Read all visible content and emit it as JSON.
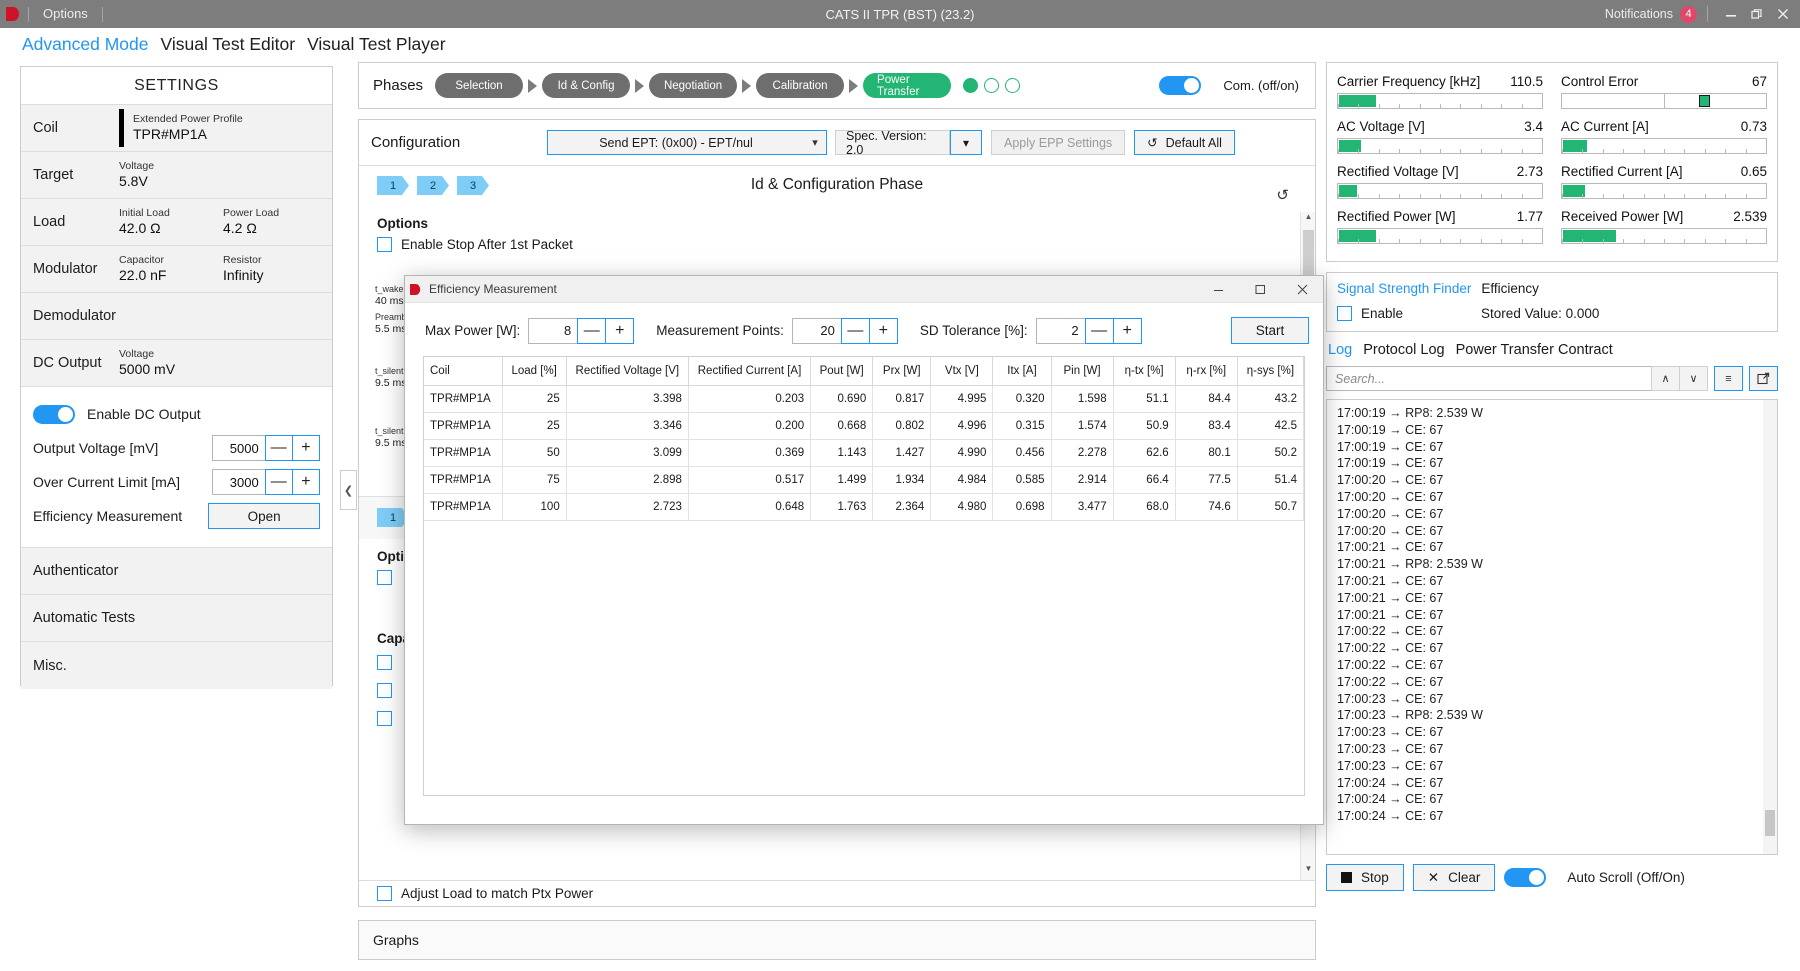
{
  "titlebar": {
    "menu": "Options",
    "app_title": "CATS II TPR (BST) (23.2)",
    "notifications_label": "Notifications",
    "notifications_count": "4",
    "minimize": "—",
    "maximize": "❐",
    "close": "✕"
  },
  "mode_tabs": [
    {
      "label": "Advanced Mode",
      "active": true
    },
    {
      "label": "Visual Test Editor",
      "active": false
    },
    {
      "label": "Visual Test Player",
      "active": false
    }
  ],
  "settings": {
    "header": "SETTINGS",
    "rows": [
      {
        "label": "Coil",
        "accent": true,
        "fields": [
          {
            "cap": "Extended Power Profile",
            "val": "TPR#MP1A"
          }
        ]
      },
      {
        "label": "Target",
        "accent": false,
        "fields": [
          {
            "cap": "Voltage",
            "val": "5.8V"
          }
        ]
      },
      {
        "label": "Load",
        "accent": false,
        "fields": [
          {
            "cap": "Initial Load",
            "val": "42.0 Ω"
          },
          {
            "cap": "Power Load",
            "val": "4.2 Ω"
          }
        ]
      },
      {
        "label": "Modulator",
        "accent": false,
        "fields": [
          {
            "cap": "Capacitor",
            "val": "22.0 nF"
          },
          {
            "cap": "Resistor",
            "val": "Infinity"
          }
        ]
      },
      {
        "label": "Demodulator",
        "accent": false,
        "fields": []
      },
      {
        "label": "DC Output",
        "accent": false,
        "fields": [
          {
            "cap": "Voltage",
            "val": "5000 mV"
          }
        ]
      }
    ],
    "dc_block": {
      "enable_label": "Enable DC Output",
      "enable_on": true,
      "output_voltage_label": "Output Voltage [mV]",
      "output_voltage_value": "5000",
      "over_current_label": "Over Current Limit [mA]",
      "over_current_value": "3000",
      "efficiency_label": "Efficiency Measurement",
      "efficiency_button": "Open",
      "minus": "—",
      "plus": "+"
    },
    "tail_rows": [
      "Authenticator",
      "Automatic Tests",
      "Misc."
    ]
  },
  "phases": {
    "title": "Phases",
    "chips": [
      "Selection",
      "Id & Config",
      "Negotiation",
      "Calibration",
      "Power Transfer"
    ],
    "active_chip": "Power Transfer",
    "dots": [
      true,
      false,
      false
    ],
    "com_label": "Com. (off/on)",
    "com_on": true
  },
  "configuration": {
    "title": "Configuration",
    "send_ept": "Send EPT: (0x00) - EPT/nul",
    "spec_version": "Spec. Version: 2.0",
    "apply_epp": "Apply EPP Settings",
    "default_all": "Default All",
    "refresh_icon": "↺",
    "num_tabs": [
      "1",
      "2",
      "3"
    ],
    "phase_heading": "Id & Configuration Phase",
    "options_heading": "Options",
    "option_stop_after": "Enable Stop After 1st Packet",
    "timings": [
      {
        "cap": "t_wake",
        "val": "40 ms"
      },
      {
        "cap": "Preamble",
        "val": "5.5 ms"
      },
      {
        "cap": "t_silent",
        "val": "9.5 ms"
      },
      {
        "cap": "t_silent",
        "val": "9.5 ms"
      }
    ],
    "lower_tab": "1",
    "lower_options_heading": "Opti",
    "capa_heading": "Capa",
    "adjust_load": "Adjust Load to match Ptx Power"
  },
  "graphs": {
    "title": "Graphs"
  },
  "meters": [
    {
      "name": "Carrier Frequency [kHz]",
      "value": "110.5",
      "fill_pct": 18,
      "type": "bar"
    },
    {
      "name": "Control Error",
      "value": "67",
      "fill_pct": 67,
      "type": "needle"
    },
    {
      "name": "AC Voltage [V]",
      "value": "3.4",
      "fill_pct": 11,
      "type": "bar"
    },
    {
      "name": "AC Current [A]",
      "value": "0.73",
      "fill_pct": 12,
      "type": "bar"
    },
    {
      "name": "Rectified Voltage [V]",
      "value": "2.73",
      "fill_pct": 9,
      "type": "bar"
    },
    {
      "name": "Rectified Current [A]",
      "value": "0.65",
      "fill_pct": 11,
      "type": "bar"
    },
    {
      "name": "Rectified Power [W]",
      "value": "1.77",
      "fill_pct": 18,
      "type": "bar"
    },
    {
      "name": "Received Power [W]",
      "value": "2.539",
      "fill_pct": 26,
      "type": "bar"
    }
  ],
  "signal_strength": {
    "tabs": [
      {
        "label": "Signal Strength Finder",
        "active": true
      },
      {
        "label": "Efficiency",
        "active": false
      }
    ],
    "enable_label": "Enable",
    "enable_checked": false,
    "stored_value": "Stored Value: 0.000"
  },
  "log": {
    "tabs": [
      {
        "label": "Log",
        "active": true
      },
      {
        "label": "Protocol Log",
        "active": false
      },
      {
        "label": "Power Transfer Contract",
        "active": false
      }
    ],
    "search_placeholder": "Search...",
    "up_icon": "∧",
    "down_icon": "∨",
    "list_icon": "≡",
    "popout_icon": "↗",
    "lines": [
      "17:00:19  → RP8: 2.539 W",
      "17:00:19  → CE: 67",
      "17:00:19  → CE: 67",
      "17:00:19  → CE: 67",
      "17:00:20  → CE: 67",
      "17:00:20  → CE: 67",
      "17:00:20  → CE: 67",
      "17:00:20  → CE: 67",
      "17:00:21  → CE: 67",
      "17:00:21  → RP8: 2.539 W",
      "17:00:21  → CE: 67",
      "17:00:21  → CE: 67",
      "17:00:21  → CE: 67",
      "17:00:22  → CE: 67",
      "17:00:22  → CE: 67",
      "17:00:22  → CE: 67",
      "17:00:22  → CE: 67",
      "17:00:23  → CE: 67",
      "17:00:23  → RP8: 2.539 W",
      "17:00:23  → CE: 67",
      "17:00:23  → CE: 67",
      "17:00:23  → CE: 67",
      "17:00:24  → CE: 67",
      "17:00:24  → CE: 67",
      "17:00:24  → CE: 67"
    ],
    "stop_button": "Stop",
    "clear_button": "Clear",
    "clear_icon": "✕",
    "autoscroll_label": "Auto Scroll (Off/On)",
    "autoscroll_on": true
  },
  "dialog": {
    "title": "Efficiency Measurement",
    "minimize": "—",
    "maximize": "□",
    "close": "✕",
    "max_power_label": "Max Power [W]:",
    "max_power_value": "8",
    "points_label": "Measurement Points:",
    "points_value": "20",
    "sd_label": "SD Tolerance [%]:",
    "sd_value": "2",
    "minus": "—",
    "plus": "+",
    "start_button": "Start",
    "table": {
      "columns": [
        "Coil",
        "Load [%]",
        "Rectified Voltage [V]",
        "Rectified Current [A]",
        "Pout [W]",
        "Prx [W]",
        "Vtx [V]",
        "Itx [A]",
        "Pin [W]",
        "η-tx [%]",
        "η-rx [%]",
        "η-sys [%]"
      ],
      "rows": [
        [
          "TPR#MP1A",
          "25",
          "3.398",
          "0.203",
          "0.690",
          "0.817",
          "4.995",
          "0.320",
          "1.598",
          "51.1",
          "84.4",
          "43.2"
        ],
        [
          "TPR#MP1A",
          "25",
          "3.346",
          "0.200",
          "0.668",
          "0.802",
          "4.996",
          "0.315",
          "1.574",
          "50.9",
          "83.4",
          "42.5"
        ],
        [
          "TPR#MP1A",
          "50",
          "3.099",
          "0.369",
          "1.143",
          "1.427",
          "4.990",
          "0.456",
          "2.278",
          "62.6",
          "80.1",
          "50.2"
        ],
        [
          "TPR#MP1A",
          "75",
          "2.898",
          "0.517",
          "1.499",
          "1.934",
          "4.984",
          "0.585",
          "2.914",
          "66.4",
          "77.5",
          "51.4"
        ],
        [
          "TPR#MP1A",
          "100",
          "2.723",
          "0.648",
          "1.763",
          "2.364",
          "4.980",
          "0.698",
          "3.477",
          "68.0",
          "74.6",
          "50.7"
        ]
      ]
    }
  },
  "colors": {
    "accent_blue": "#2196f3",
    "green": "#22b573",
    "titlebar": "#7d7d7d",
    "badge_red": "#e0486b"
  }
}
